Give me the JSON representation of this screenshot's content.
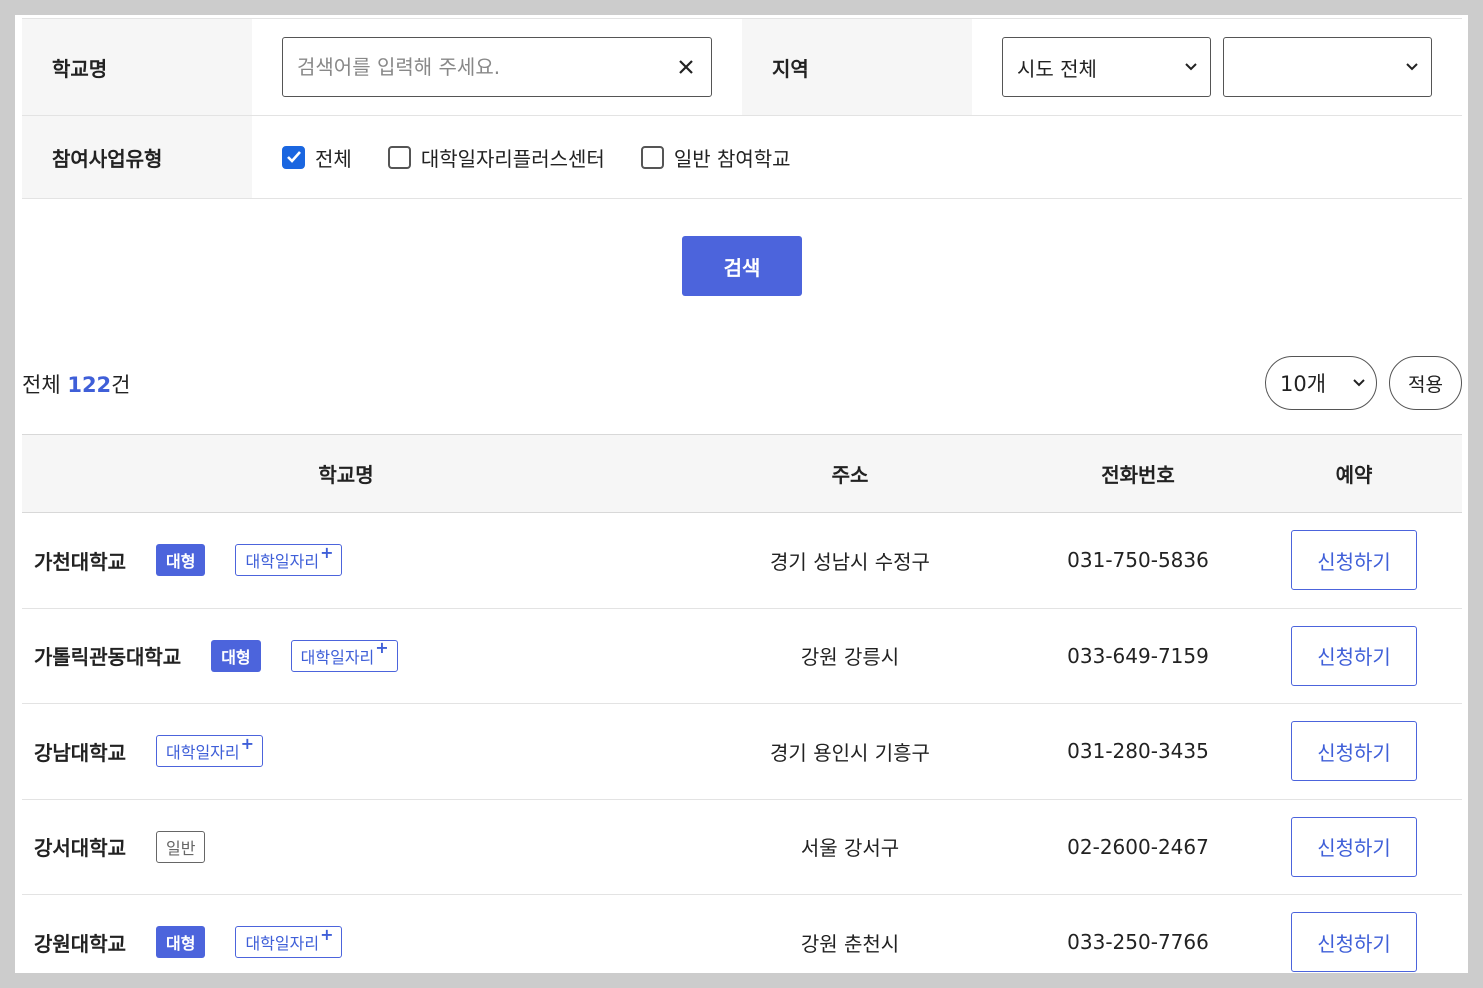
{
  "filter": {
    "school_label": "학교명",
    "search_placeholder": "검색어를 입력해 주세요.",
    "search_value": "",
    "region_label": "지역",
    "region_select_value": "시도 전체",
    "subregion_select_value": "",
    "type_label": "참여사업유형",
    "checkboxes": [
      {
        "label": "전체",
        "checked": true
      },
      {
        "label": "대학일자리플러스센터",
        "checked": false
      },
      {
        "label": "일반 참여학교",
        "checked": false
      }
    ],
    "search_button": "검색"
  },
  "summary": {
    "prefix": "전체 ",
    "count": "122",
    "suffix": "건",
    "per_page_value": "10개",
    "apply_button": "적용"
  },
  "table": {
    "headers": [
      "학교명",
      "주소",
      "전화번호",
      "예약"
    ],
    "rows": [
      {
        "name": "가천대학교",
        "badge_large": "대형",
        "badge_plus": "대학일자리",
        "badge_general": null,
        "address": "경기 성남시 수정구",
        "phone": "031-750-5836",
        "action": "신청하기"
      },
      {
        "name": "가톨릭관동대학교",
        "badge_large": "대형",
        "badge_plus": "대학일자리",
        "badge_general": null,
        "address": "강원 강릉시",
        "phone": "033-649-7159",
        "action": "신청하기"
      },
      {
        "name": "강남대학교",
        "badge_large": null,
        "badge_plus": "대학일자리",
        "badge_general": null,
        "address": "경기 용인시 기흥구",
        "phone": "031-280-3435",
        "action": "신청하기"
      },
      {
        "name": "강서대학교",
        "badge_large": null,
        "badge_plus": null,
        "badge_general": "일반",
        "address": "서울 강서구",
        "phone": "02-2600-2467",
        "action": "신청하기"
      },
      {
        "name": "강원대학교",
        "badge_large": "대형",
        "badge_plus": "대학일자리",
        "badge_general": null,
        "address": "강원 춘천시",
        "phone": "033-250-7766",
        "action": "신청하기"
      }
    ],
    "plus_mark": "+"
  },
  "colors": {
    "accent": "#4c64dc",
    "checkbox": "#1a66e0",
    "header_bg": "#f6f6f6"
  }
}
